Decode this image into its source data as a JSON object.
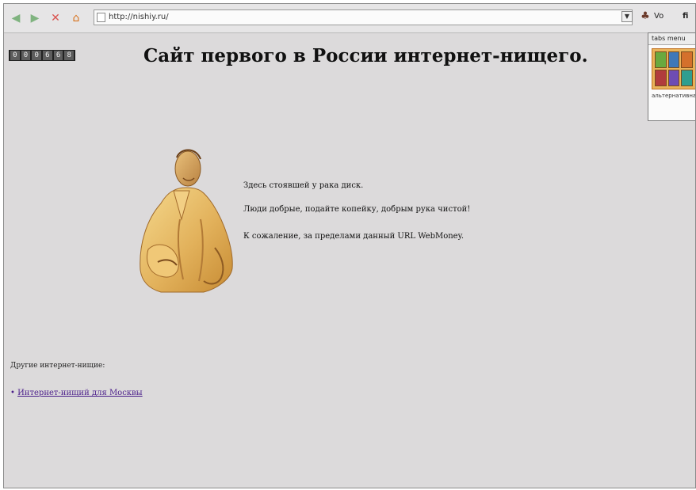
{
  "toolbar": {
    "nav": {
      "back_icon": "back-arrow-icon",
      "forward_icon": "forward-arrow-icon",
      "stop_icon": "stop-icon",
      "home_icon": "home-icon"
    },
    "address_text": "http://nishiy.ru/",
    "dropdown_symbol": "▼",
    "extension_label": "Vo",
    "tail_text": "fi"
  },
  "page": {
    "counter_digits": [
      "0",
      "0",
      "0",
      "6",
      "6",
      "8"
    ],
    "title": "Сайт первого в России интернет-нищего.",
    "lines": [
      "Здесь стоявшей у рака диск.",
      "Люди добрые, подайте копейку, добрым рука чистой!",
      "К сожаление, за пределами данный URL WebMoney."
    ],
    "footer_text": "Другие интернет-нищие:",
    "footer_link": "Интернет-нищий для Москвы"
  },
  "popup": {
    "header": "tabs menu",
    "footer": "альтернативная..."
  },
  "colors": {
    "page_background": "#dcdadb",
    "link": "#4a1d8a",
    "popup_orange": "#e9b35a"
  }
}
